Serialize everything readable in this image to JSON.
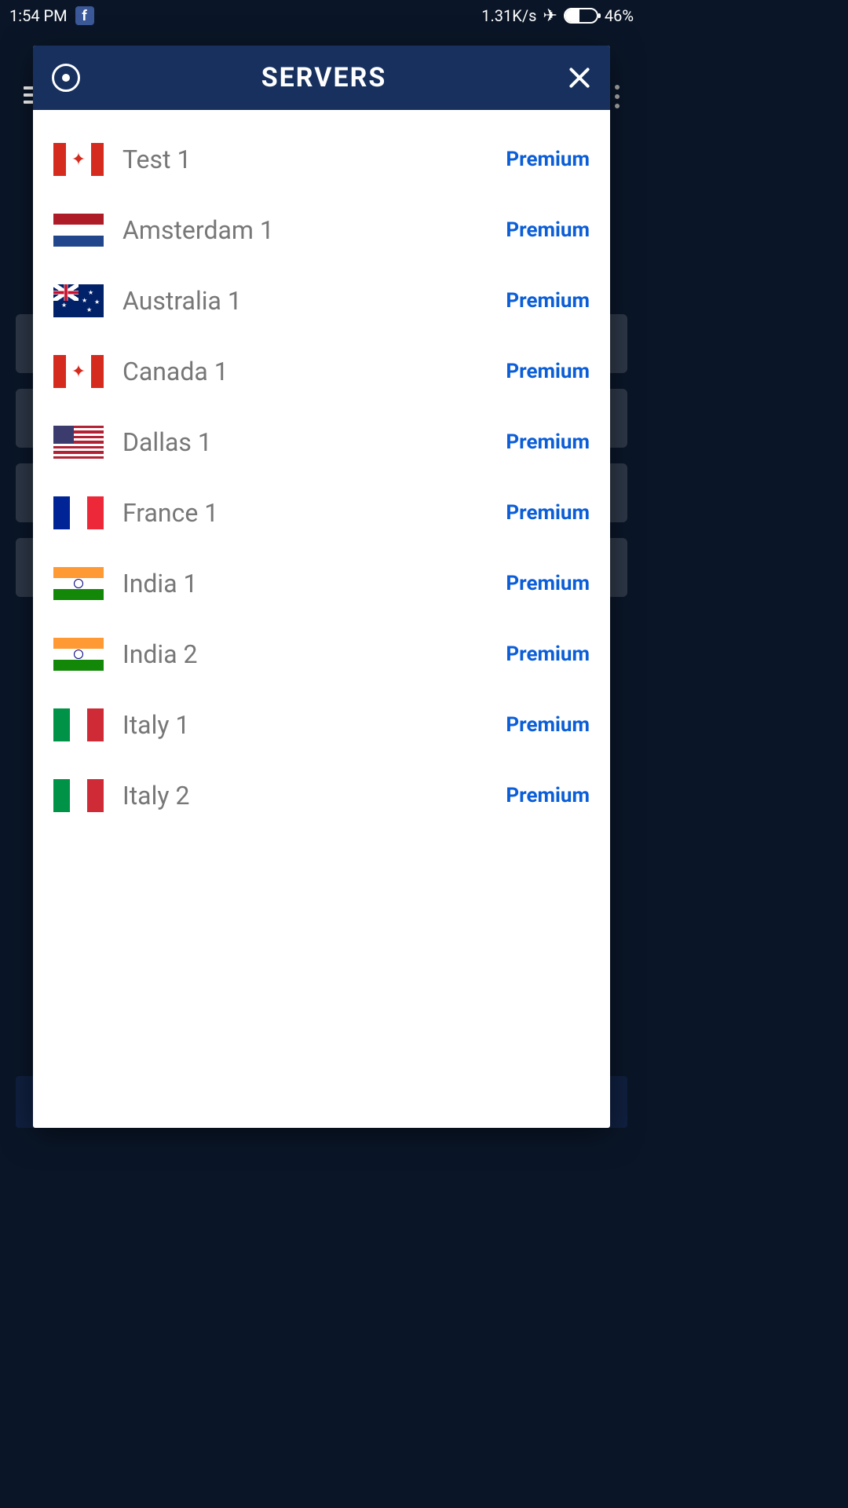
{
  "status": {
    "time": "1:54 PM",
    "speed": "1.31K/s",
    "battery_pct": "46%"
  },
  "modal": {
    "title": "SERVERS"
  },
  "servers": [
    {
      "name": "Test 1",
      "badge": "Premium",
      "flag": "ca"
    },
    {
      "name": "Amsterdam 1",
      "badge": "Premium",
      "flag": "nl"
    },
    {
      "name": "Australia 1",
      "badge": "Premium",
      "flag": "au"
    },
    {
      "name": "Canada 1",
      "badge": "Premium",
      "flag": "ca"
    },
    {
      "name": "Dallas 1",
      "badge": "Premium",
      "flag": "us"
    },
    {
      "name": "France 1",
      "badge": "Premium",
      "flag": "fr"
    },
    {
      "name": "India 1",
      "badge": "Premium",
      "flag": "in"
    },
    {
      "name": "India 2",
      "badge": "Premium",
      "flag": "in"
    },
    {
      "name": "Italy 1",
      "badge": "Premium",
      "flag": "it"
    },
    {
      "name": "Italy 2",
      "badge": "Premium",
      "flag": "it"
    }
  ]
}
